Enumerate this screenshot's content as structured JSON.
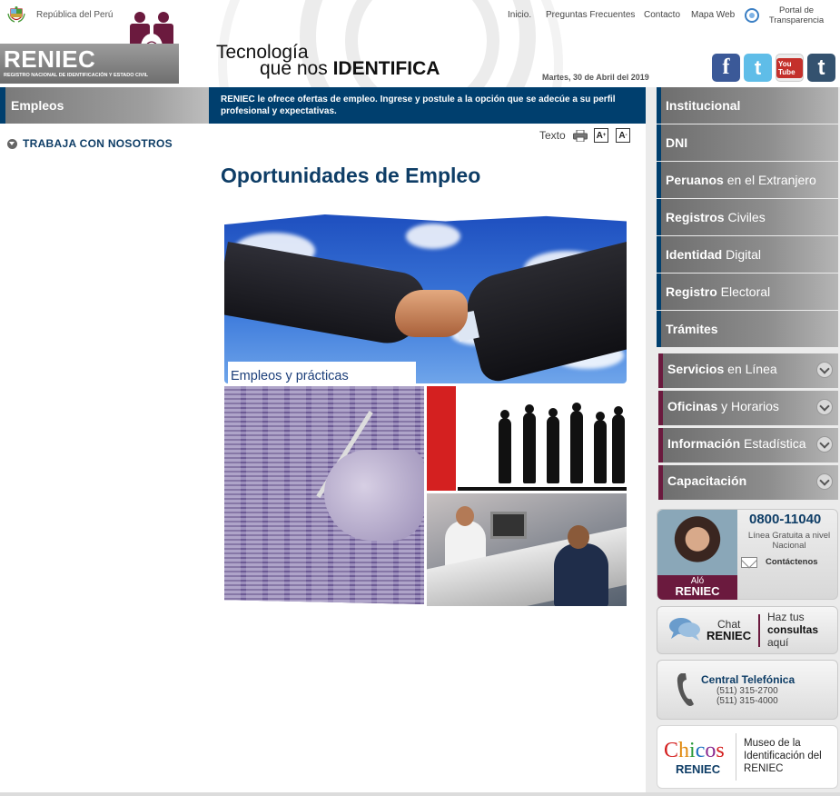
{
  "header": {
    "country_label": "República del Perú",
    "logo_text": "RENIEC",
    "logo_subtitle": "REGISTRO NACIONAL DE IDENTIFICACIÓN Y ESTADO CIVIL",
    "tagline_line1": "Tecnología",
    "tagline_line2_prefix": "que nos ",
    "tagline_line2_bold": "IDENTIFICA",
    "date": "Martes, 30 de Abril del 2019",
    "nav": [
      "Inicio.",
      "Preguntas Frecuentes",
      "Contacto",
      "Mapa Web"
    ],
    "portal_label": "Portal de Transparencia",
    "social": [
      {
        "name": "facebook",
        "glyph": "f"
      },
      {
        "name": "twitter",
        "glyph": "t"
      },
      {
        "name": "youtube",
        "glyph": "You Tube"
      },
      {
        "name": "tumblr",
        "glyph": "t"
      }
    ]
  },
  "left": {
    "section_title": "Empleos",
    "link": "TRABAJA CON NOSOTROS"
  },
  "main": {
    "intro": "RENIEC le ofrece ofertas de empleo. Ingrese y postule a la opción que se adecúe a su perfil profesional y expectativas.",
    "text_tool": "Texto",
    "font_up": "A",
    "font_down": "A",
    "page_title": "Oportunidades de Empleo",
    "image_caption": "Empleos y prácticas"
  },
  "right": {
    "nav": [
      {
        "bold": "Institucional",
        "rest": ""
      },
      {
        "bold": "DNI",
        "rest": ""
      },
      {
        "bold": "Peruanos",
        "rest": " en el Extranjero"
      },
      {
        "bold": "Registros",
        "rest": " Civiles"
      },
      {
        "bold": "Identidad",
        "rest": " Digital"
      },
      {
        "bold": "Registro",
        "rest": " Electoral"
      },
      {
        "bold": "Trámites",
        "rest": ""
      }
    ],
    "services": [
      {
        "bold": "Servicios",
        "rest": " en Línea"
      },
      {
        "bold": "Oficinas",
        "rest": " y Horarios"
      },
      {
        "bold": "Información",
        "rest": " Estadística"
      },
      {
        "bold": "Capacitación",
        "rest": ""
      }
    ],
    "alo": {
      "label_top": "Aló",
      "label_bottom": "RENIEC",
      "phone": "0800-11040",
      "line_text": "Línea Gratuita a nivel Nacional",
      "contact": "Contáctenos"
    },
    "chat": {
      "label_top": "Chat",
      "label_bottom": "RENIEC",
      "line1": "Haz tus",
      "line2": "consultas",
      "line3": "aquí"
    },
    "central": {
      "title": "Central Telefónica",
      "number1": "(511) 315-2700",
      "number2": "(511) 315-4000"
    },
    "chicos": {
      "logo": "Chicos",
      "sub": "RENIEC",
      "text": "Museo de la Identificación del RENIEC"
    }
  },
  "colors": {
    "navy": "#003f6e",
    "title_blue": "#0e3d66",
    "maroon": "#6b1a3e",
    "nav_grey": "#8d8d8d"
  }
}
